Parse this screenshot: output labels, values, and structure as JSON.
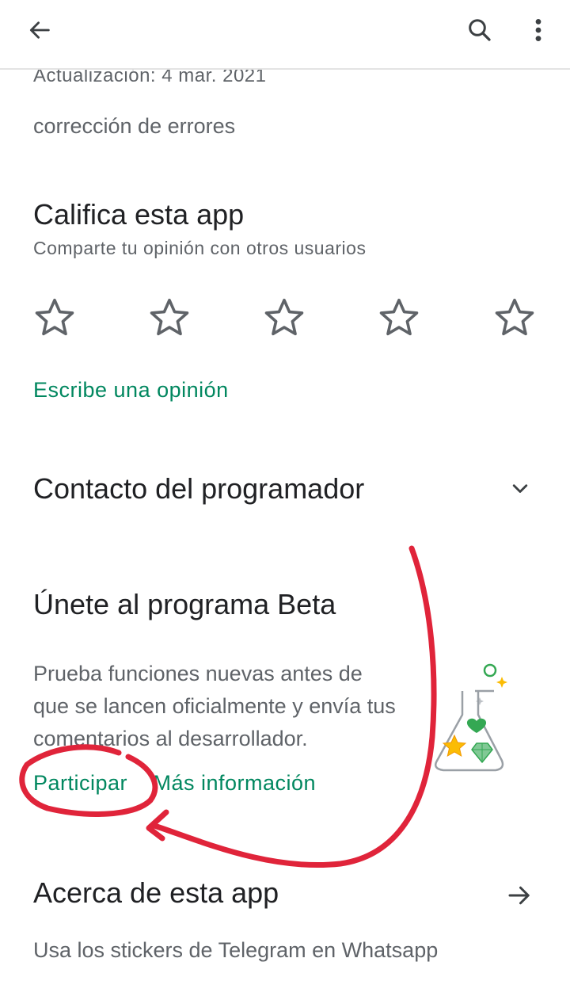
{
  "topbar": {
    "back_icon": "arrow-back-icon",
    "search_icon": "search-icon",
    "menu_icon": "more-vert-icon"
  },
  "whats_new": {
    "update_line": "Actualización: 4 mar. 2021",
    "notes": "corrección de errores"
  },
  "rating": {
    "title": "Califica esta app",
    "subtitle": "Comparte tu opinión con otros usuarios",
    "stars": 5,
    "selected": 0,
    "write_review": "Escribe una opinión"
  },
  "contact": {
    "title": "Contacto del programador",
    "chevron_icon": "chevron-down-icon"
  },
  "beta": {
    "title": "Únete al programa Beta",
    "description": "Prueba funciones nuevas antes de que se lancen oficialmente y envía tus comentarios al desarrollador.",
    "join_label": "Participar",
    "more_info_label": "Más información",
    "illustration_icon": "beta-flask-icon"
  },
  "about": {
    "title": "Acerca de esta app",
    "description": "Usa los stickers de Telegram en Whatsapp",
    "arrow_icon": "arrow-forward-icon"
  },
  "colors": {
    "accent": "#01875f",
    "annotation": "#e0243a",
    "text_primary": "#202124",
    "text_secondary": "#5f6368"
  }
}
